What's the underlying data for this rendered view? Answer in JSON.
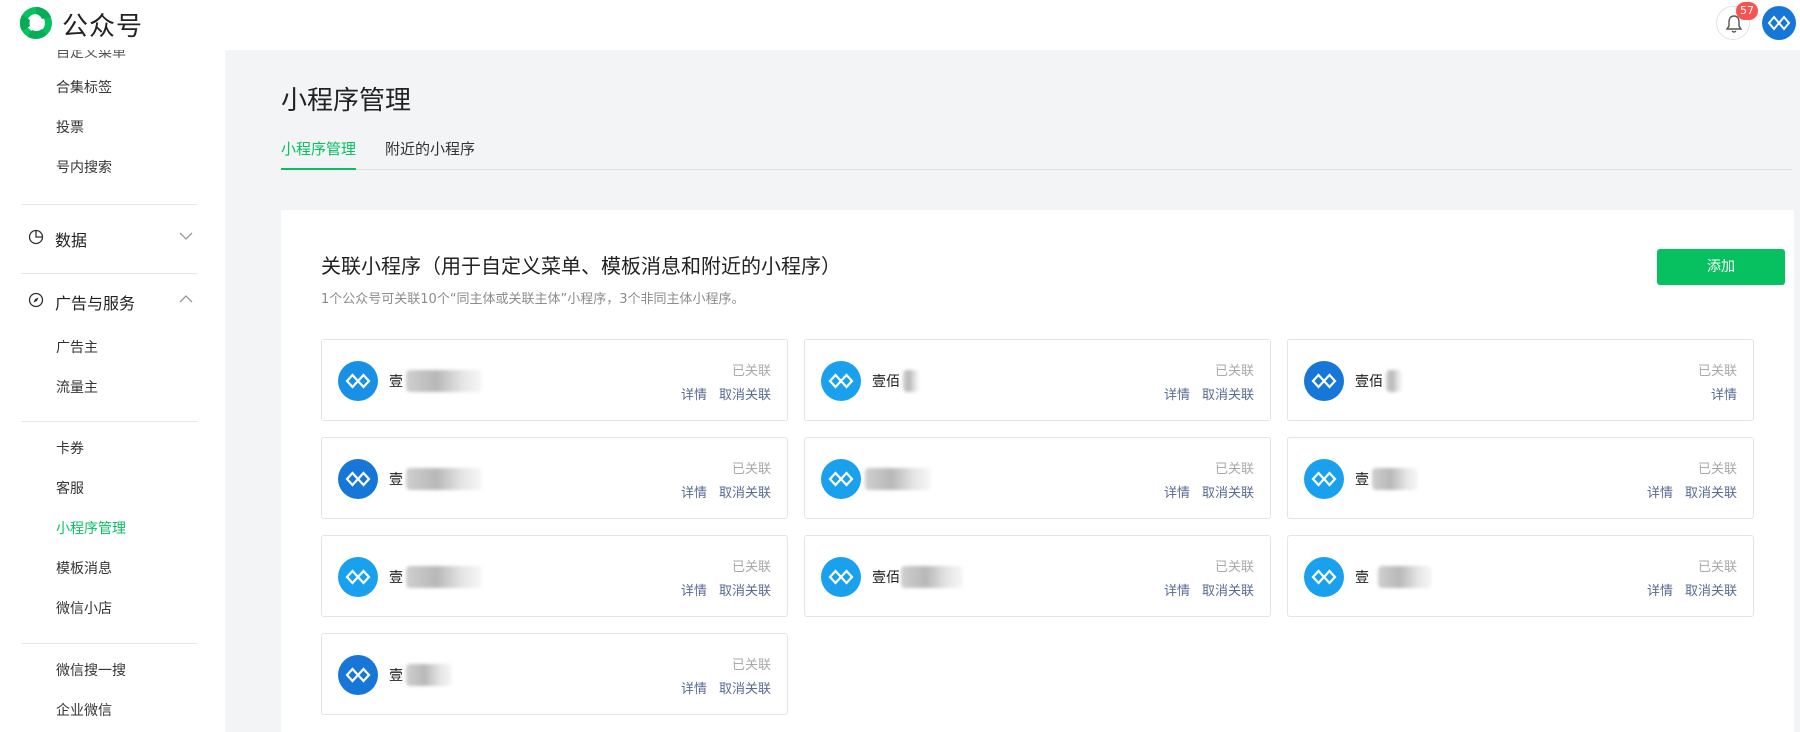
{
  "header": {
    "brand": "公众号",
    "notifications_count": "57",
    "brand_color": "#07c160"
  },
  "sidebar": {
    "cut_item": "自定义菜单",
    "items_top": [
      "合集标签",
      "投票",
      "号内搜索"
    ],
    "group_data": "数据",
    "group_ads": "广告与服务",
    "ads_items": [
      "广告主",
      "流量主"
    ],
    "items_mid": [
      "卡券",
      "客服",
      "小程序管理",
      "模板消息",
      "微信小店"
    ],
    "items_bottom": [
      "微信搜一搜",
      "企业微信"
    ]
  },
  "main": {
    "title": "小程序管理",
    "tabs": [
      "小程序管理",
      "附近的小程序"
    ],
    "section_title": "关联小程序（用于自定义菜单、模板消息和附近的小程序）",
    "section_desc": "1个公众号可关联10个“同主体或关联主体”小程序，3个非同主体小程序。",
    "add_button": "添加",
    "cards": [
      {
        "name": "壹",
        "status": "已关联",
        "detail": "详情",
        "unlink": "取消关联",
        "logo_color": "#1890e6"
      },
      {
        "name": "壹佰",
        "status": "已关联",
        "detail": "详情",
        "unlink": "取消关联",
        "logo_color": "#1aa1ee"
      },
      {
        "name": "壹佰",
        "status": "已关联",
        "detail": "详情",
        "unlink": "",
        "logo_color": "#1677d9"
      },
      {
        "name": "壹",
        "status": "已关联",
        "detail": "详情",
        "unlink": "取消关联",
        "logo_color": "#1677d9"
      },
      {
        "name": "",
        "status": "已关联",
        "detail": "详情",
        "unlink": "取消关联",
        "logo_color": "#1aa1ee"
      },
      {
        "name": "壹",
        "status": "已关联",
        "detail": "详情",
        "unlink": "取消关联",
        "logo_color": "#1aa1ee"
      },
      {
        "name": "壹",
        "status": "已关联",
        "detail": "详情",
        "unlink": "取消关联",
        "logo_color": "#1aa1ee"
      },
      {
        "name": "壹佰",
        "status": "已关联",
        "detail": "详情",
        "unlink": "取消关联",
        "logo_color": "#1aa1ee"
      },
      {
        "name": "壹",
        "status": "已关联",
        "detail": "详情",
        "unlink": "取消关联",
        "logo_color": "#1aa1ee"
      },
      {
        "name": "壹",
        "status": "已关联",
        "detail": "详情",
        "unlink": "取消关联",
        "logo_color": "#1677d9"
      }
    ]
  }
}
